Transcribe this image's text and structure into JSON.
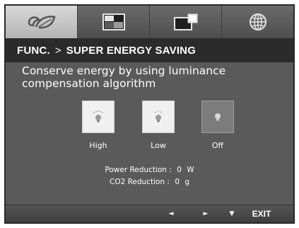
{
  "tabs": [
    {
      "icon": "eco-leaf-icon"
    },
    {
      "icon": "picture-icon"
    },
    {
      "icon": "dual-screen-icon"
    },
    {
      "icon": "globe-icon"
    }
  ],
  "header": {
    "section": "FUNC.",
    "separator": ">",
    "title": "SUPER ENERGY SAVING"
  },
  "description": {
    "line1": "Conserve energy by using luminance",
    "line2": "compensation algorithm"
  },
  "options": [
    {
      "label": "High",
      "icon": "bulb-high-icon"
    },
    {
      "label": "Low",
      "icon": "bulb-low-icon"
    },
    {
      "label": "Off",
      "icon": "bulb-off-icon",
      "selected": true
    }
  ],
  "power": {
    "label": "Power Reduction :",
    "value": "0",
    "unit": "W"
  },
  "co2": {
    "label": "CO2 Reduction :",
    "value": "0",
    "unit": "g"
  },
  "footer": {
    "left_arrow": "◄",
    "right_arrow": "►",
    "down_arrow": "▼",
    "exit": "EXIT"
  },
  "colors": {
    "panel": "#5a5a5a",
    "header_bar": "#2b2b2b",
    "active_tab": "#c8c8c8",
    "selected_option": "#7c7c7c"
  }
}
